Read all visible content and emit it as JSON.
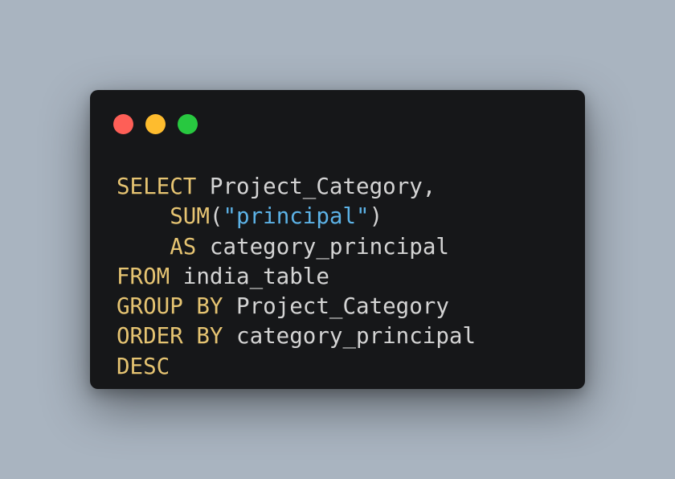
{
  "window": {
    "controls": [
      {
        "name": "close",
        "color": "#fe5f57"
      },
      {
        "name": "minimize",
        "color": "#febc2e"
      },
      {
        "name": "maximize",
        "color": "#28c840"
      }
    ]
  },
  "code": {
    "language": "sql",
    "lines": [
      [
        {
          "t": "kw",
          "v": "SELECT"
        },
        {
          "t": "pl",
          "v": " Project_Category,"
        }
      ],
      [
        {
          "t": "pl",
          "v": "    "
        },
        {
          "t": "fn",
          "v": "SUM"
        },
        {
          "t": "pl",
          "v": "("
        },
        {
          "t": "str",
          "v": "\"principal\""
        },
        {
          "t": "pl",
          "v": ")"
        }
      ],
      [
        {
          "t": "pl",
          "v": "    "
        },
        {
          "t": "kw",
          "v": "AS"
        },
        {
          "t": "pl",
          "v": " category_principal"
        }
      ],
      [
        {
          "t": "kw",
          "v": "FROM"
        },
        {
          "t": "pl",
          "v": " india_table"
        }
      ],
      [
        {
          "t": "kw",
          "v": "GROUP BY"
        },
        {
          "t": "pl",
          "v": " Project_Category"
        }
      ],
      [
        {
          "t": "kw",
          "v": "ORDER BY"
        },
        {
          "t": "pl",
          "v": " category_principal"
        }
      ],
      [
        {
          "t": "kw",
          "v": "DESC"
        }
      ]
    ]
  }
}
